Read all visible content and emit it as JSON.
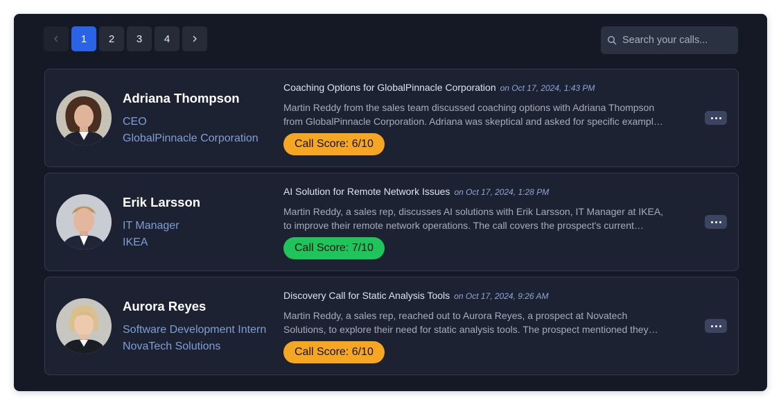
{
  "pagination": {
    "prev_icon": "chevron-left-icon",
    "next_icon": "chevron-right-icon",
    "pages": [
      "1",
      "2",
      "3",
      "4"
    ],
    "active_page": "1"
  },
  "search": {
    "placeholder": "Search your calls...",
    "icon": "search-icon"
  },
  "colors": {
    "score_warning": "#f5a623",
    "score_good": "#1fc45a",
    "active_page": "#2b63e6"
  },
  "calls": [
    {
      "name": "Adriana Thompson",
      "role": "CEO",
      "company": "GlobalPinnacle Corporation",
      "title": "Coaching Options for GlobalPinnacle Corporation",
      "date": "on Oct 17, 2024, 1:43 PM",
      "summary": "Martin Reddy from the sales team discussed coaching options with Adriana Thompson from GlobalPinnacle Corporation. Adriana was skeptical and asked for specific examples of how the coaching would help her team.",
      "score": "Call Score: 6/10",
      "score_color": "#f5a623"
    },
    {
      "name": "Erik Larsson",
      "role": "IT Manager",
      "company": "IKEA",
      "title": "AI Solution for Remote Network Issues",
      "date": "on Oct 17, 2024, 1:28 PM",
      "summary": "Martin Reddy, a sales rep, discusses AI solutions with Erik Larsson, IT Manager at IKEA, to improve their remote network operations. The call covers the prospect's current challenges and next steps.",
      "score": "Call Score: 7/10",
      "score_color": "#1fc45a"
    },
    {
      "name": "Aurora Reyes",
      "role": "Software Development Intern",
      "company": "NovaTech Solutions",
      "title": "Discovery Call for Static Analysis Tools",
      "date": "on Oct 17, 2024, 9:26 AM",
      "summary": "Martin Reddy, a sales rep, reached out to Aurora Reyes, a prospect at Novatech Solutions, to explore their need for static analysis tools. The prospect mentioned they are evaluating several options.",
      "score": "Call Score: 6/10",
      "score_color": "#f5a623"
    }
  ]
}
